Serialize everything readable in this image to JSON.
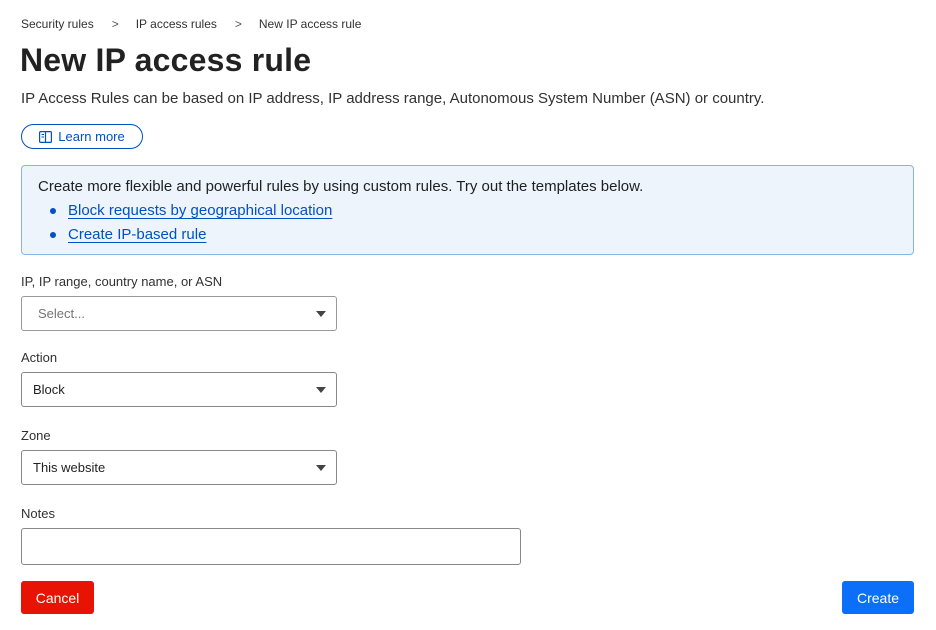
{
  "breadcrumb": {
    "items": [
      "Security rules",
      "IP access rules",
      "New IP access rule"
    ],
    "separator": ">"
  },
  "page": {
    "title": "New IP access rule",
    "description": "IP Access Rules can be based on IP address, IP address range, Autonomous System Number (ASN) or country.",
    "learn_more_label": "Learn more"
  },
  "info_box": {
    "text": "Create more flexible and powerful rules by using custom rules. Try out the templates below.",
    "links": [
      "Block requests by geographical location",
      "Create IP-based rule"
    ]
  },
  "form": {
    "target": {
      "label": "IP, IP range, country name, or ASN",
      "placeholder": "Select..."
    },
    "action": {
      "label": "Action",
      "value": "Block"
    },
    "zone": {
      "label": "Zone",
      "value": "This website"
    },
    "notes": {
      "label": "Notes",
      "value": ""
    }
  },
  "buttons": {
    "cancel": "Cancel",
    "create": "Create"
  },
  "colors": {
    "link": "#0051c3",
    "info_bg": "#edf4fc",
    "info_border": "#86b5e6",
    "cancel": "#e81403",
    "create": "#0b6ff7"
  },
  "icons": {
    "learn_more": "book-open-icon",
    "select_caret": "caret-down-icon",
    "breadcrumb_separator": "chevron-right-icon"
  }
}
